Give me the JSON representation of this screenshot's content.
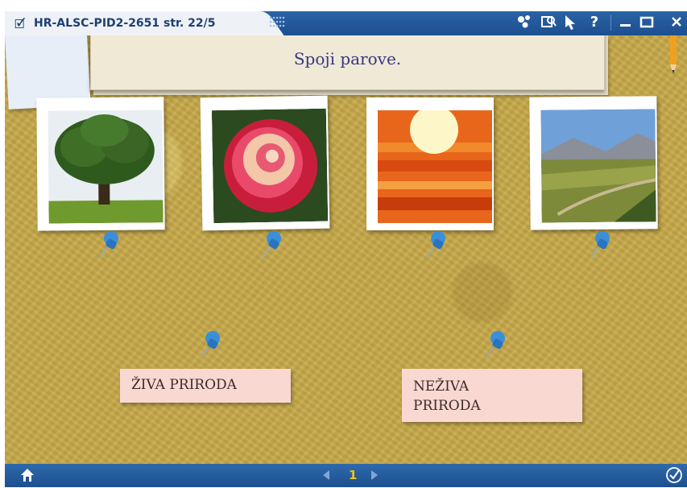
{
  "window": {
    "title": "HR-ALSC-PID2-2651 str. 22/5",
    "doc_icon": "document-edit-icon",
    "toolbar_icons": [
      "tools-icon",
      "zoom-icon",
      "pointer-icon",
      "help-icon",
      "minimize-icon",
      "maximize-icon",
      "close-icon"
    ],
    "help_glyph": "?",
    "accent_color": "#1d4f8e"
  },
  "activity": {
    "instruction": "Spoji parove.",
    "images": [
      {
        "name": "tree",
        "icon": "tree-photo"
      },
      {
        "name": "rose",
        "icon": "rose-photo"
      },
      {
        "name": "sunset",
        "icon": "sunset-photo"
      },
      {
        "name": "landscape",
        "icon": "valley-landscape-photo"
      }
    ],
    "labels": [
      {
        "text": "ŽIVA PRIRODA"
      },
      {
        "line1": "NEŽIVA",
        "line2": "PRIRODA"
      }
    ]
  },
  "footer": {
    "page": "1",
    "home_icon": "home-icon",
    "check_icon": "checkmark-icon"
  }
}
